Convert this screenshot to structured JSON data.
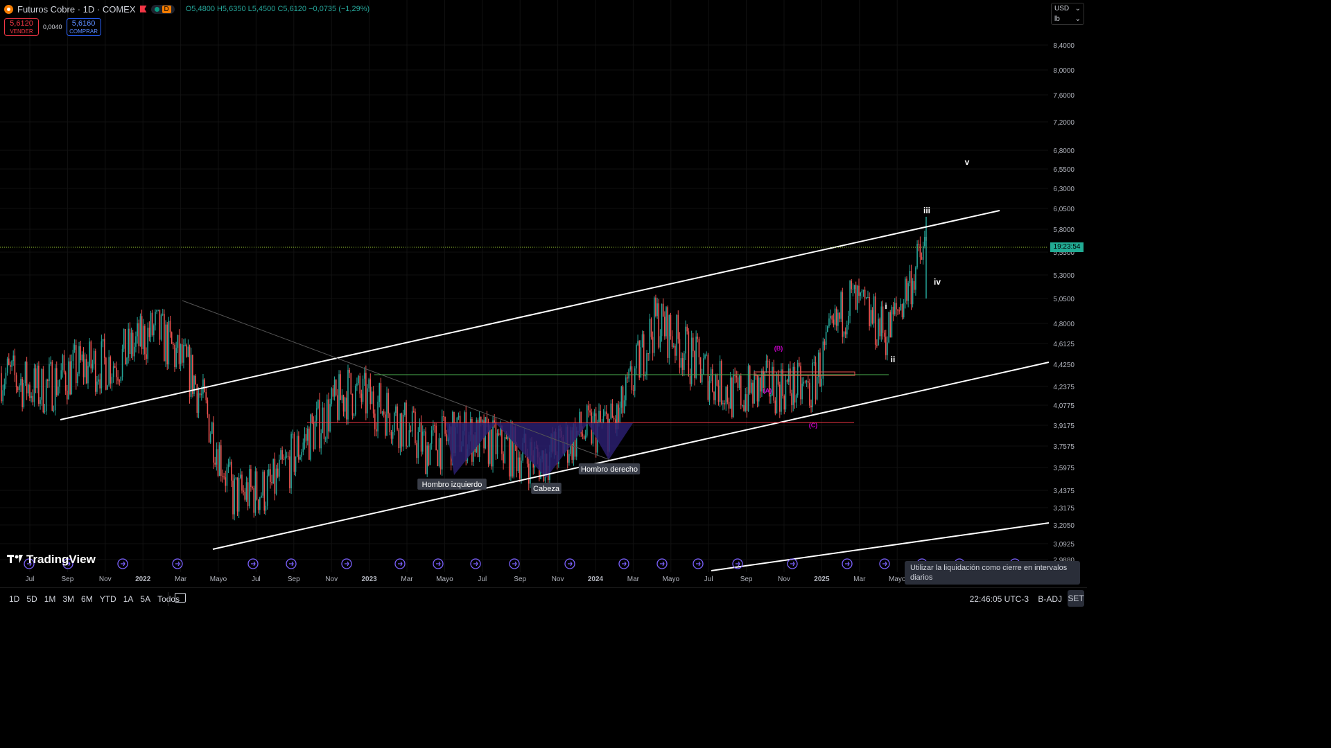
{
  "header": {
    "title": "Futuros Cobre · 1D · COMEX",
    "d_tag": "D",
    "ohlc": "O5,4800 H5,6350 L5,4500 C5,6120 −0,0735 (−1,29%)"
  },
  "trade": {
    "sell_price": "5,6120",
    "sell_label": "VENDER",
    "spread": "0,0040",
    "buy_price": "5,6160",
    "buy_label": "COMPRAR"
  },
  "currency": {
    "code": "USD",
    "unit": "lb"
  },
  "price_axis": {
    "ticks": [
      "8,4000",
      "8,0000",
      "7,6000",
      "7,2000",
      "6,8000",
      "6,5500",
      "6,3000",
      "6,0500",
      "5,8000",
      "5,5500",
      "5,3000",
      "5,0500",
      "4,8000",
      "4,6125",
      "4,4250",
      "4,2375",
      "4,0775",
      "3,9175",
      "3,7575",
      "3,5975",
      "3,4375",
      "3,3175",
      "3,2050",
      "3,0925",
      "2,9880"
    ],
    "countdown": "19:23:54"
  },
  "time_axis": [
    "Jul",
    "Sep",
    "Nov",
    "2022",
    "Mar",
    "Mayo",
    "Jul",
    "Sep",
    "Nov",
    "2023",
    "Mar",
    "Mayo",
    "Jul",
    "Sep",
    "Nov",
    "2024",
    "Mar",
    "Mayo",
    "Jul",
    "Sep",
    "Nov",
    "2025",
    "Mar",
    "Mayo"
  ],
  "annotations": {
    "left_shoulder": "Hombro izquierdo",
    "head": "Cabeza",
    "right_shoulder": "Hombro derecho",
    "wave_i": "i",
    "wave_ii": "ii",
    "wave_iii": "iii",
    "wave_iv": "iv",
    "wave_v": "v",
    "wave_a": "(A)",
    "wave_b": "(B)",
    "wave_c": "(C)"
  },
  "chart_data": {
    "type": "candlestick",
    "title": "Futuros Cobre · 1D · COMEX",
    "ylim": [
      2.95,
      8.6
    ],
    "y_scale": "log",
    "x": [
      "2021-07",
      "2021-09",
      "2021-11",
      "2022-01",
      "2022-03",
      "2022-05",
      "2022-07",
      "2022-09",
      "2022-11",
      "2023-01",
      "2023-03",
      "2023-05",
      "2023-07",
      "2023-09",
      "2023-11",
      "2024-01",
      "2024-03",
      "2024-05",
      "2024-07",
      "2024-09",
      "2024-11",
      "2025-01",
      "2025-03",
      "2025-05",
      "2025-07"
    ],
    "close": [
      4.35,
      4.2,
      4.4,
      4.45,
      4.75,
      4.3,
      3.4,
      3.45,
      3.85,
      4.2,
      4.05,
      3.75,
      3.85,
      3.75,
      3.65,
      3.85,
      3.95,
      4.85,
      4.45,
      4.15,
      4.25,
      4.2,
      5.05,
      4.7,
      5.612
    ],
    "last_close": 5.612,
    "current_price_line": 5.612,
    "grid": true
  },
  "bottom": {
    "timeframes": [
      "1D",
      "5D",
      "1M",
      "3M",
      "6M",
      "YTD",
      "1A",
      "5A",
      "Todos"
    ],
    "clock": "22:46:05 UTC-3",
    "adj": "B-ADJ",
    "set": "SET",
    "tooltip": "Utilizar la liquidación como cierre en intervalos diarios"
  },
  "colors": {
    "up": "#26a69a",
    "down": "#ef5350",
    "pattern_fill": "#2a1f6e",
    "resistance": "#4caf50",
    "support": "#f23645"
  }
}
